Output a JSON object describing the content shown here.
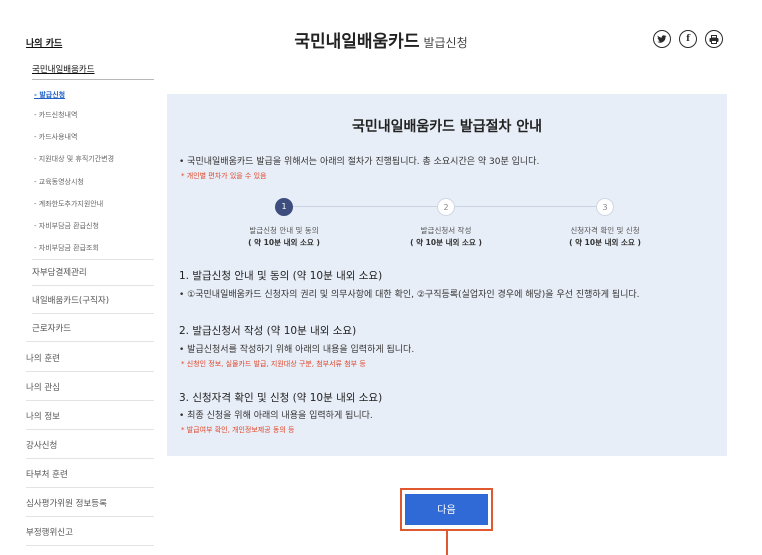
{
  "sidebar": {
    "top": "나의 카드",
    "sub": "국민내일배움카드",
    "items": [
      {
        "label": "- 발급신청",
        "active": true
      },
      {
        "label": "- 카드신청내역",
        "active": false
      },
      {
        "label": "- 카드사용내역",
        "active": false
      },
      {
        "label": "- 지원대상 및 휴직기간변경",
        "active": false
      },
      {
        "label": "- 교육동영상시청",
        "active": false
      },
      {
        "label": "- 계좌한도추가지원안내",
        "active": false
      },
      {
        "label": "- 자비부담금 환급신청",
        "active": false
      },
      {
        "label": "- 자비부담금 환급조회",
        "active": false
      }
    ],
    "sub_menus": [
      "자부담결제관리",
      "내일배움카드(구직자)",
      "근로자카드"
    ],
    "main_menus": [
      "나의 훈련",
      "나의 관심",
      "나의 정보",
      "강사신청",
      "타부처 훈련",
      "심사평가위원 정보등록",
      "부정행위신고"
    ]
  },
  "header": {
    "title": "국민내일배움카드",
    "subtitle": "발급신청",
    "icons": [
      "twitter-icon",
      "facebook-icon",
      "print-icon"
    ]
  },
  "info": {
    "title": "국민내일배움카드 발급절차 안내",
    "intro": "• 국민내일배움카드 발급을 위해서는 아래의 절차가 진행됩니다. 총 소요시간은 약 30분 입니다.",
    "intro_note": "* 개인별 편차가 있을 수 있음",
    "steps": [
      {
        "num": "1",
        "label": "발급신청 안내 및 동의",
        "time": "( 약 10분 내외 소요 )",
        "current": true
      },
      {
        "num": "2",
        "label": "발급신청서 작성",
        "time": "( 약 10분 내외 소요 )",
        "current": false
      },
      {
        "num": "3",
        "label": "신청자격 확인 및 신청",
        "time": "( 약 10분 내외 소요 )",
        "current": false
      }
    ],
    "sections": [
      {
        "heading": "1. 발급신청 안내 및 동의 (약 10분 내외 소요)",
        "text": "• ①국민내일배움카드 신청자의 권리 및 의무사항에 대한 확인, ②구직등록(실업자인 경우에 해당)을 우선 진행하게 됩니다.",
        "note": ""
      },
      {
        "heading": "2. 발급신청서 작성 (약 10분 내외 소요)",
        "text": "• 발급신청서를 작성하기 위해 아래의 내용을 입력하게 됩니다.",
        "note": "* 신청인 정보, 실물카드 발급, 지원대상 구분, 첨부서류 첨부 등"
      },
      {
        "heading": "3. 신청자격 확인 및 신청 (약 10분 내외 소요)",
        "text": "• 최종 신청을 위해 아래의 내용을 입력하게 됩니다.",
        "note": "* 발급여부 확인, 개인정보제공 동의 등"
      }
    ]
  },
  "next_button": "다음",
  "colors": {
    "accent": "#2f6ad6",
    "highlight": "#e0582f",
    "panel": "#e8eef7",
    "step_active": "#3c4d7e"
  }
}
